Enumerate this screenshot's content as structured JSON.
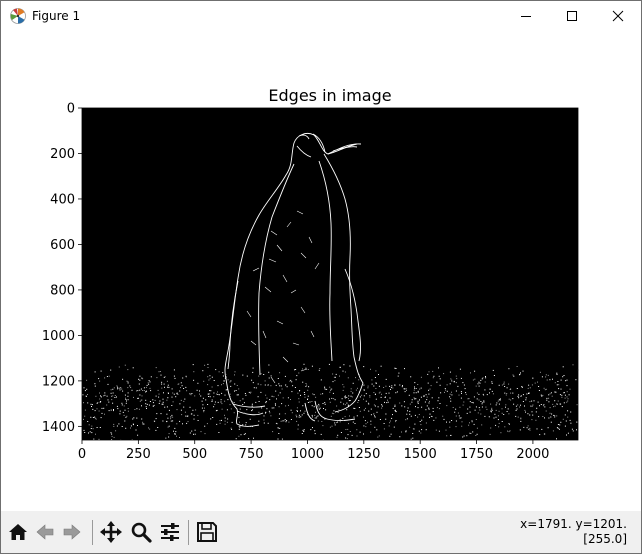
{
  "window": {
    "title": "Figure 1"
  },
  "chart_data": {
    "type": "heatmap",
    "title": "Edges in image",
    "xlabel": "",
    "ylabel": "",
    "xlim": [
      0,
      2200
    ],
    "ylim": [
      1460,
      0
    ],
    "xticks": [
      0,
      250,
      500,
      750,
      1000,
      1250,
      1500,
      1750,
      2000
    ],
    "yticks": [
      0,
      200,
      400,
      600,
      800,
      1000,
      1200,
      1400
    ],
    "colormap": "gray",
    "background": "#000000",
    "edge_color": "#ffffff",
    "grid": false,
    "legend": "none"
  },
  "toolbar": {
    "home": "home-icon",
    "back": "back-arrow-icon",
    "forward": "forward-arrow-icon",
    "pan": "move-icon",
    "zoom": "zoom-icon",
    "configure": "sliders-icon",
    "save": "save-icon"
  },
  "status": {
    "coords": "x=1791. y=1201.",
    "value": "[255.0]"
  }
}
